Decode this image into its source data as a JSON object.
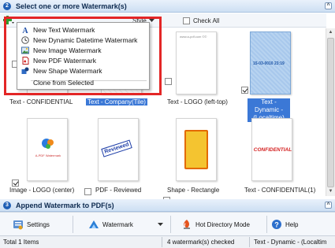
{
  "section1": {
    "step": "2",
    "title": "Select one or more Watermark(s)"
  },
  "toolbar": {
    "style_label": "Style",
    "check_all_label": "Check All"
  },
  "menu": {
    "items": [
      {
        "label": "New Text Watermark",
        "icon": "text-a-icon"
      },
      {
        "label": "New Dynamic Datetime Watermark",
        "icon": "clock-icon"
      },
      {
        "label": "New Image Watermark",
        "icon": "image-icon"
      },
      {
        "label": "New PDF Watermark",
        "icon": "pdf-icon"
      },
      {
        "label": "New Shape Watermark",
        "icon": "shapes-icon"
      }
    ],
    "clone_label": "Clone from Selected"
  },
  "cards": [
    {
      "caption": "Text - CONFIDENTIAL",
      "checked": false,
      "selected": false
    },
    {
      "caption": "Text - Company(Tile)",
      "checked": false,
      "selected": true
    },
    {
      "caption": "Text - LOGO (left-top)",
      "checked": false,
      "selected": false,
      "thumb_text": "www.a-pdf.com ©©"
    },
    {
      "caption": "Text - Dynamic - (Localtime)",
      "checked": true,
      "selected": true,
      "thumb_text": "15-03-0010 23:19"
    },
    {
      "caption": "Image - LOGO (center)",
      "checked": true,
      "selected": false,
      "thumb_text": "A-PDF Watermark"
    },
    {
      "caption": "PDF - Reviewed",
      "checked": false,
      "selected": false,
      "thumb_text": "Reviewed"
    },
    {
      "caption": "Shape - Rectangle",
      "checked": false,
      "selected": false
    },
    {
      "caption": "Text - CONFIDENTIAL(1)",
      "checked": false,
      "selected": false,
      "thumb_text": "CONFIDENTIAL"
    }
  ],
  "section2": {
    "step": "3",
    "title": "Append Watermark to PDF(s)"
  },
  "bottom": {
    "settings": "Settings",
    "watermark": "Watermark",
    "hot_directory": "Hot Directory Mode",
    "help": "Help"
  },
  "status": {
    "total": "Total 1 Items",
    "checked": "4 watermark(s) checked",
    "current": "Text - Dynamic - (Localtim"
  },
  "colors": {
    "accent": "#3b78d6",
    "highlight": "#e32626",
    "confidential": "#d42020",
    "reviewed": "#1e3ea8",
    "shape_fill": "#f4c430",
    "shape_stroke": "#e36a00"
  }
}
